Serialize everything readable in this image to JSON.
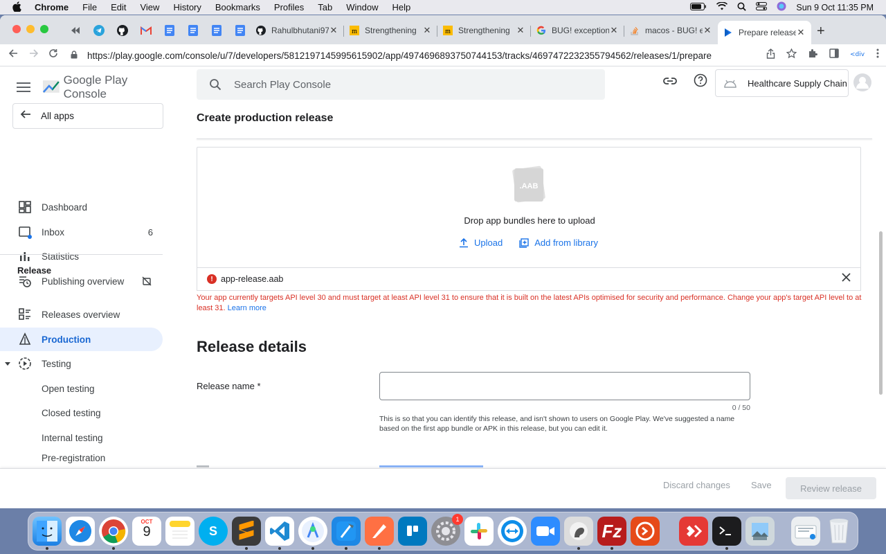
{
  "menubar": {
    "app": "Chrome",
    "items": [
      "File",
      "Edit",
      "View",
      "History",
      "Bookmarks",
      "Profiles",
      "Tab",
      "Window",
      "Help"
    ],
    "clock": "Sun 9 Oct  11:35 PM"
  },
  "tabs": [
    {
      "label": "Rahulbhutani97",
      "icon": "github-icon"
    },
    {
      "label": "Strengthening",
      "icon": "medium-icon"
    },
    {
      "label": "Strengthening",
      "icon": "medium-icon"
    },
    {
      "label": "BUG! exception",
      "icon": "google-icon"
    },
    {
      "label": "macos - BUG! e",
      "icon": "stackoverflow-icon"
    },
    {
      "label": "Prepare release",
      "icon": "play-console-icon",
      "active": true
    }
  ],
  "toolbar": {
    "url": "https://play.google.com/console/u/7/developers/5812197145995615902/app/4974696893750744153/tracks/4697472232355794562/releases/1/prepare"
  },
  "console": {
    "brand_google": "Google Play",
    "brand_console": "Console",
    "search_placeholder": "Search Play Console",
    "account": "Healthcare Supply Chain",
    "all_apps": "All apps"
  },
  "sidebar": {
    "items": [
      {
        "label": "Dashboard",
        "icon": "dashboard-icon"
      },
      {
        "label": "Inbox",
        "icon": "inbox-icon",
        "count": "6"
      },
      {
        "label": "Statistics",
        "icon": "statistics-icon"
      },
      {
        "label": "Publishing overview",
        "icon": "publishing-overview-icon"
      }
    ],
    "release_section": "Release",
    "release_items": [
      {
        "label": "Releases overview",
        "icon": "releases-overview-icon"
      },
      {
        "label": "Production",
        "icon": "production-icon",
        "active": true
      },
      {
        "label": "Testing",
        "icon": "testing-icon"
      }
    ],
    "testing_items": [
      "Open testing",
      "Closed testing",
      "Internal testing",
      "Pre-registration"
    ]
  },
  "main": {
    "title": "Create production release",
    "aab_badge": ".AAB",
    "drop_text": "Drop app bundles here to upload",
    "upload_label": "Upload",
    "library_label": "Add from library",
    "file_name": "app-release.aab",
    "error_text": "Your app currently targets API level 30 and must target at least API level 31 to ensure that it is built on the latest APIs optimised for security and performance. Change your app's target API level to at least 31.",
    "learn_more": "Learn more",
    "details_heading": "Release details",
    "release_name_label": "Release name  *",
    "release_name_value": "",
    "counter": "0 / 50",
    "help_text": "This is so that you can identify this release, and isn't shown to users on Google Play. We've suggested a name based on the first app bundle or APK in this release, but you can edit it."
  },
  "footer": {
    "discard": "Discard changes",
    "save": "Save",
    "review": "Review release"
  },
  "dock": {
    "calendar_month": "OCT",
    "calendar_day": "9",
    "settings_badge": "1"
  },
  "colors": {
    "accent": "#1a73e8",
    "error": "#d93025",
    "active_nav_bg": "#e8f0fe"
  }
}
